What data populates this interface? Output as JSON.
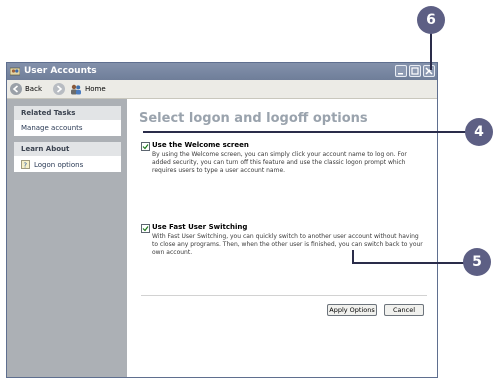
{
  "window": {
    "title": "User Accounts",
    "colors": {
      "titlebar": "#7a88a2",
      "sidebar": "#acb0b5",
      "heading": "#9aa3ad",
      "callout": "#5d5f84"
    }
  },
  "toolbar": {
    "back_label": "Back",
    "home_label": "Home"
  },
  "sidebar": {
    "related_tasks": {
      "header": "Related Tasks",
      "items": [
        "Manage accounts"
      ]
    },
    "learn_about": {
      "header": "Learn About",
      "items": [
        "Logon options"
      ]
    }
  },
  "main": {
    "heading": "Select logon and logoff options",
    "options": [
      {
        "title": "Use the Welcome screen",
        "checked": true,
        "description": "By using the Welcome screen, you can simply click your account name to log on. For added security, you can turn off this feature and use the classic logon prompt which requires users to type a user account name."
      },
      {
        "title": "Use Fast User Switching",
        "checked": true,
        "description": "With Fast User Switching, you can quickly switch to another user account without having to close any programs. Then, when the other user is finished, you can switch back to your own account."
      }
    ],
    "apply_label": "Apply Options",
    "cancel_label": "Cancel"
  },
  "callouts": [
    "6",
    "4",
    "5"
  ]
}
